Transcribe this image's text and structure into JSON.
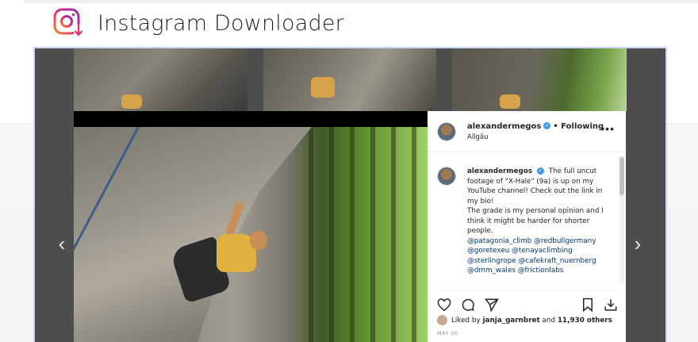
{
  "app": {
    "title": "Instagram Downloader",
    "logo_icon": "instagram-download-icon"
  },
  "viewer": {
    "prev_icon": "chevron-left-icon",
    "next_icon": "chevron-right-icon",
    "prev_glyph": "‹",
    "next_glyph": "›"
  },
  "post": {
    "username": "alexandermegos",
    "follow_status": "• Following",
    "location": "Allgäu",
    "more_glyph": "•••",
    "caption": {
      "username": "alexandermegos",
      "text1": "The full uncut footage of \"X-Hale\" (9a) is up on my YouTube channel! Check out the link in my bio!",
      "text2": "The grade is my personal opinion and I think it might be harder for shorter people.",
      "tags": "@patagonia_climb @redbullgermany @goretexeu @tenayaclimbing @sterlingrope @cafekraft_nuernberg @dmm_wales @frictionlabs"
    },
    "likes": {
      "prefix": "Liked by",
      "user": "janja_garnbret",
      "middle": "and",
      "count": "11,930 others"
    },
    "date": "MAY 30"
  },
  "colors": {
    "verified": "#3897f0",
    "tag": "#00376b",
    "viewer_bg": "#4d4d4d"
  }
}
